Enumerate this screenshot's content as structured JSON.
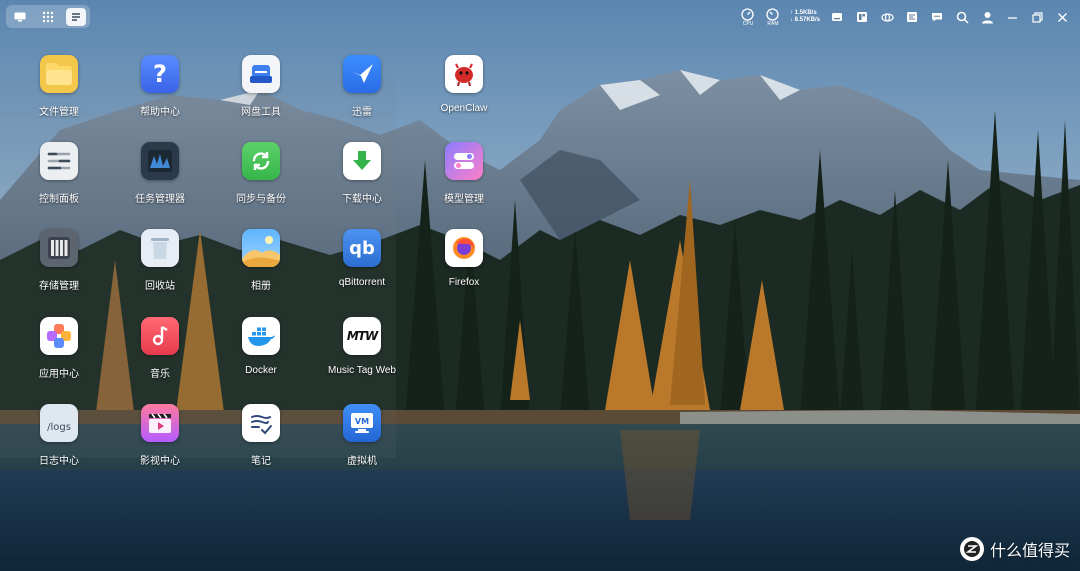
{
  "topbar": {
    "meters": [
      {
        "name": "cpu",
        "label": "CPU"
      },
      {
        "name": "ram",
        "label": "RAM"
      }
    ],
    "net_up": "↑ 1.5KB/s",
    "net_down": "↓ 8.57KB/s"
  },
  "apps": [
    {
      "label": "文件管理",
      "icon": "folder-icon"
    },
    {
      "label": "帮助中心",
      "icon": "question-icon"
    },
    {
      "label": "网盘工具",
      "icon": "drive-icon"
    },
    {
      "label": "迅雷",
      "icon": "bird-icon"
    },
    {
      "label": "OpenClaw",
      "icon": "red-creature-icon"
    },
    {
      "label": "控制面板",
      "icon": "sliders-icon"
    },
    {
      "label": "任务管理器",
      "icon": "monitor-chart-icon"
    },
    {
      "label": "同步与备份",
      "icon": "sync-icon"
    },
    {
      "label": "下载中心",
      "icon": "download-arrow-icon"
    },
    {
      "label": "模型管理",
      "icon": "toggles-icon"
    },
    {
      "label": "存储管理",
      "icon": "drive-bays-icon"
    },
    {
      "label": "回收站",
      "icon": "trash-bin-icon"
    },
    {
      "label": "相册",
      "icon": "landscape-photo-icon"
    },
    {
      "label": "qBittorrent",
      "icon": "qb-icon",
      "text": "qb"
    },
    {
      "label": "Firefox",
      "icon": "firefox-icon"
    },
    {
      "label": "应用中心",
      "icon": "app-grid-icon"
    },
    {
      "label": "音乐",
      "icon": "music-note-icon"
    },
    {
      "label": "Docker",
      "icon": "docker-whale-icon"
    },
    {
      "label": "Music Tag Web",
      "icon": "mtw-logo-icon",
      "text": "MTW"
    },
    {
      "label": "/logs",
      "icon": "logs-doc-icon",
      "text": "/logs"
    },
    {
      "label": "日志中心",
      "icon": "logs-doc-icon"
    },
    {
      "label": "影视中心",
      "icon": "clapperboard-icon"
    },
    {
      "label": "笔记",
      "icon": "note-pen-icon"
    },
    {
      "label": "虚拟机",
      "icon": "vm-monitor-icon",
      "text": "VM"
    }
  ],
  "watermark": {
    "text": "什么值得买",
    "icon": "smzdm-logo-icon"
  }
}
